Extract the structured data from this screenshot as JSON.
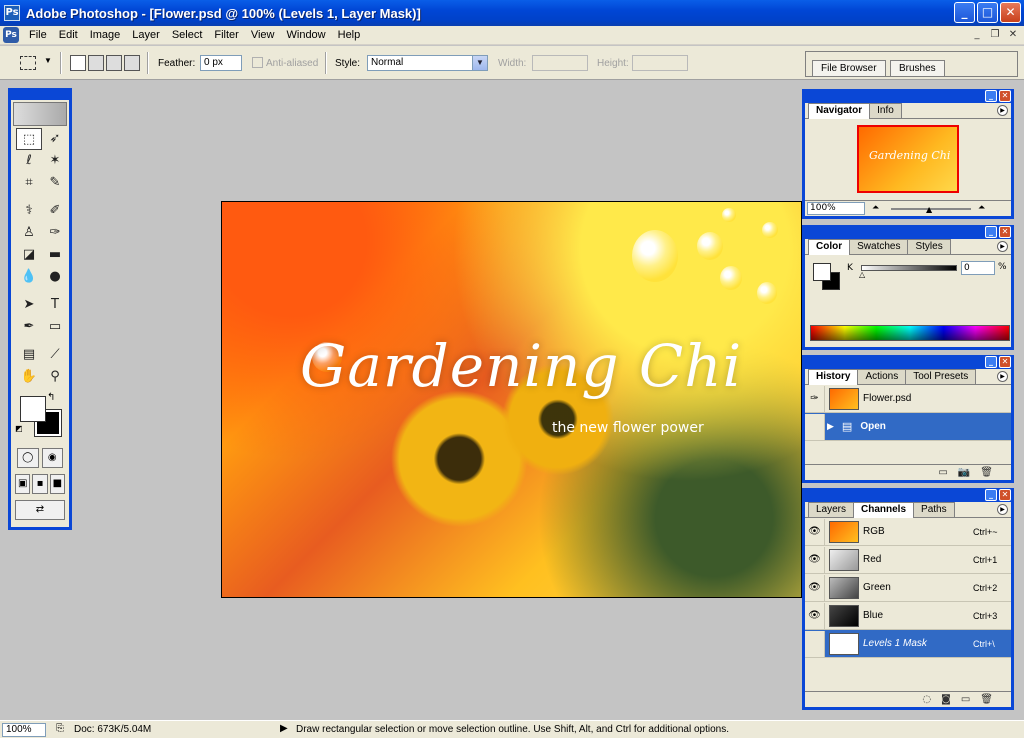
{
  "window": {
    "title": "Adobe Photoshop - [Flower.psd @ 100% (Levels 1, Layer Mask)]",
    "app_icon": "photoshop-icon",
    "buttons": {
      "minimize": "_",
      "maximize": "□",
      "close": "✕"
    }
  },
  "menubar": {
    "items": [
      "File",
      "Edit",
      "Image",
      "Layer",
      "Select",
      "Filter",
      "View",
      "Window",
      "Help"
    ]
  },
  "options": {
    "feather_label": "Feather:",
    "feather_value": "0 px",
    "antialiased_label": "Anti-aliased",
    "style_label": "Style:",
    "style_value": "Normal",
    "width_label": "Width:",
    "height_label": "Height:"
  },
  "palette_well": {
    "tabs": [
      "File Browser",
      "Brushes"
    ]
  },
  "canvas": {
    "title": "Gardening Chi",
    "subtitle": "the new flower power"
  },
  "navigator": {
    "tabs": [
      "Navigator",
      "Info"
    ],
    "zoom": "100%",
    "thumb_text": "Gardening Chi"
  },
  "color": {
    "tabs": [
      "Color",
      "Swatches",
      "Styles"
    ],
    "k_label": "K",
    "k_value": "0",
    "unit": "%"
  },
  "history": {
    "tabs": [
      "History",
      "Actions",
      "Tool Presets"
    ],
    "snapshot": "Flower.psd",
    "states": [
      "Open"
    ]
  },
  "channels": {
    "tabs": [
      "Layers",
      "Channels",
      "Paths"
    ],
    "rows": [
      {
        "name": "RGB",
        "shortcut": "Ctrl+~"
      },
      {
        "name": "Red",
        "shortcut": "Ctrl+1"
      },
      {
        "name": "Green",
        "shortcut": "Ctrl+2"
      },
      {
        "name": "Blue",
        "shortcut": "Ctrl+3"
      },
      {
        "name": "Levels 1 Mask",
        "shortcut": "Ctrl+\\"
      }
    ]
  },
  "status": {
    "zoom": "100%",
    "doc": "Doc: 673K/5.04M",
    "message": "Draw rectangular selection or move selection outline.  Use Shift, Alt, and Ctrl for additional options."
  },
  "colors": {
    "titlebar": "#0046d5",
    "selection": "#316ac5",
    "panel_bg": "#ece9d8"
  }
}
